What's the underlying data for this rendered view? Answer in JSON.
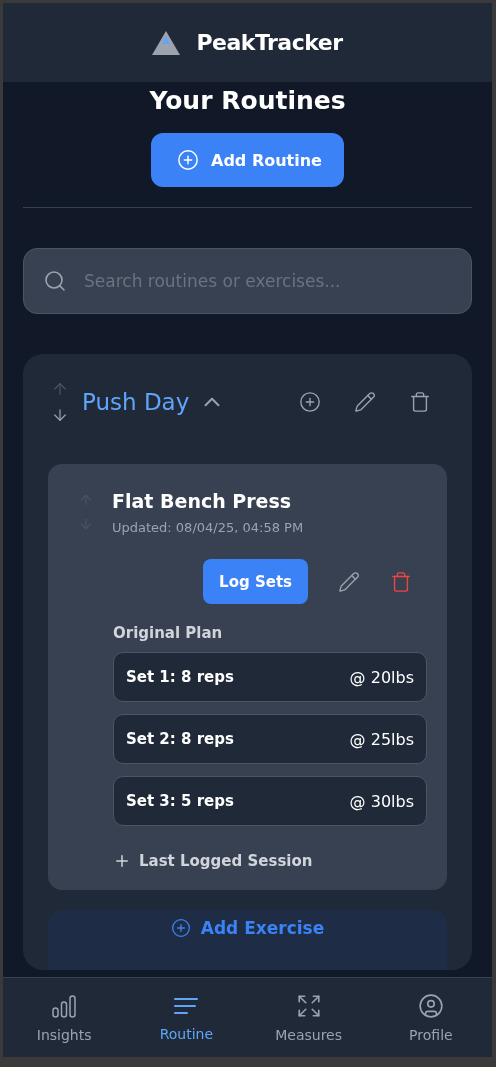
{
  "app": {
    "title": "PeakTracker"
  },
  "page": {
    "title": "Your Routines",
    "add_button": "Add Routine"
  },
  "search": {
    "placeholder": "Search routines or exercises..."
  },
  "routines": [
    {
      "name": "Push Day",
      "expanded": true,
      "up_disabled": true,
      "down_disabled": false,
      "exercises": [
        {
          "name": "Flat Bench Press",
          "updated": "Updated: 08/04/25, 04:58 PM",
          "up_disabled": true,
          "down_disabled": true,
          "log_button": "Log Sets",
          "plan_title": "Original Plan",
          "sets": [
            {
              "label": "Set 1: 8 reps",
              "weight": "@ 20lbs"
            },
            {
              "label": "Set 2: 8 reps",
              "weight": "@ 25lbs"
            },
            {
              "label": "Set 3: 5 reps",
              "weight": "@ 30lbs"
            }
          ],
          "last_session": {
            "label": "Last Logged Session",
            "expanded": false
          }
        }
      ],
      "add_exercise": "Add Exercise"
    }
  ],
  "nav": [
    {
      "label": "Insights",
      "selected": false
    },
    {
      "label": "Routine",
      "selected": true
    },
    {
      "label": "Measures",
      "selected": false
    },
    {
      "label": "Profile",
      "selected": false
    }
  ]
}
